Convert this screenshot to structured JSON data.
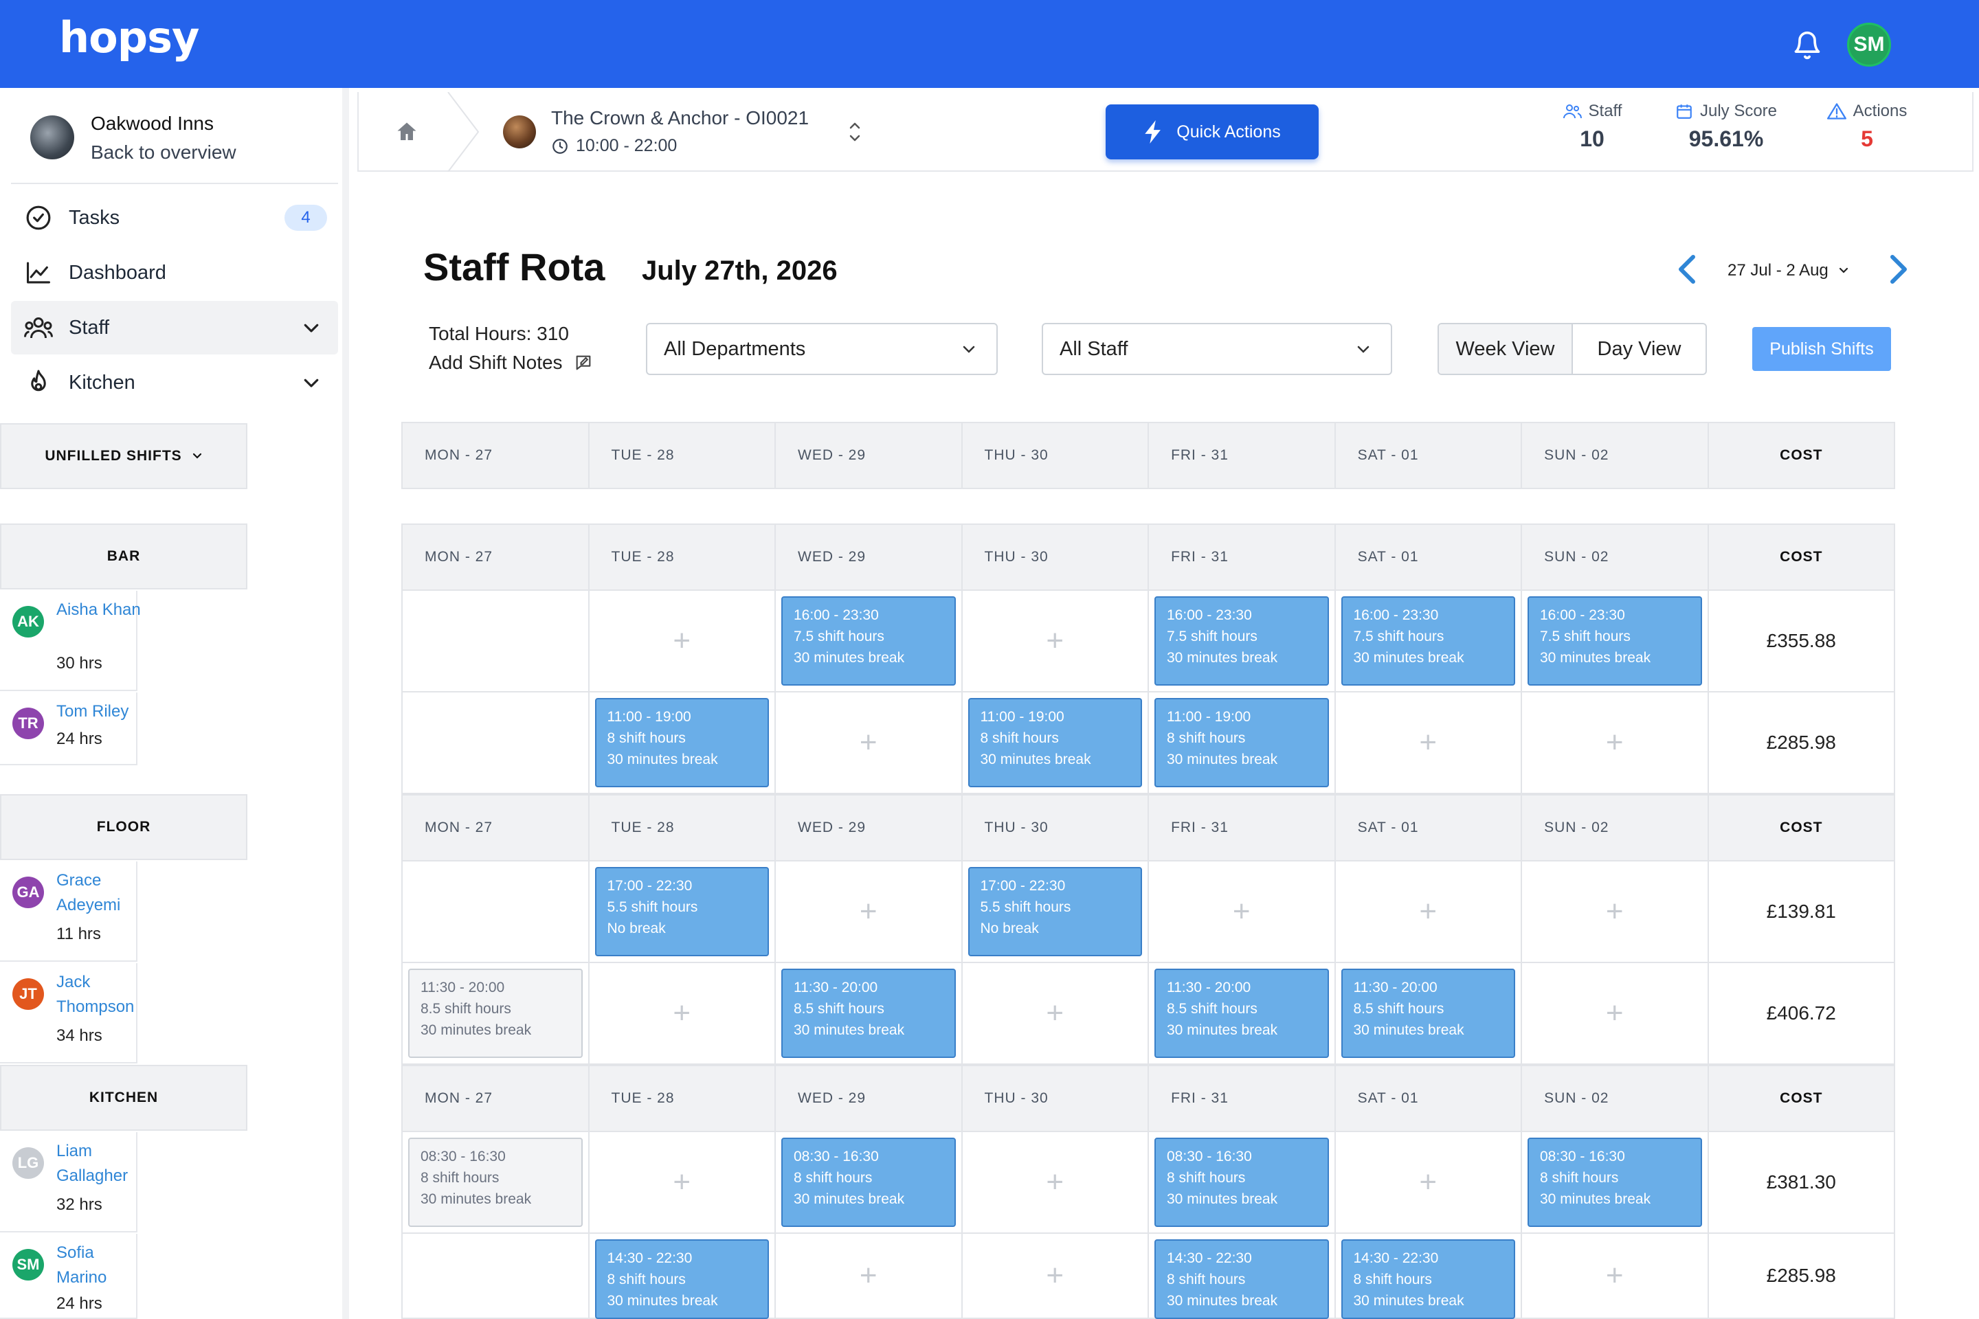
{
  "app": {
    "logo": "hopsy",
    "user_initials": "SM"
  },
  "sidebar": {
    "org_name": "Oakwood Inns",
    "back_label": "Back to overview",
    "items": [
      {
        "label": "Tasks",
        "badge": "4"
      },
      {
        "label": "Dashboard"
      },
      {
        "label": "Staff"
      },
      {
        "label": "Kitchen"
      }
    ],
    "unfilled_label": "UNFILLED SHIFTS",
    "departments": [
      {
        "name": "BAR",
        "employees": [
          {
            "initials": "AK",
            "name": "Aisha Khan",
            "hours": "30 hrs",
            "color": "#1aa66a"
          },
          {
            "initials": "TR",
            "name": "Tom Riley",
            "hours": "24 hrs",
            "color": "#8e44ad"
          }
        ]
      },
      {
        "name": "FLOOR",
        "employees": [
          {
            "initials": "GA",
            "name": "Grace Adeyemi",
            "hours": "11 hrs",
            "color": "#8e44ad"
          },
          {
            "initials": "JT",
            "name": "Jack Thompson",
            "hours": "34 hrs",
            "color": "#e2571e"
          }
        ]
      },
      {
        "name": "KITCHEN",
        "employees": [
          {
            "initials": "LG",
            "name": "Liam Gallagher",
            "hours": "32 hrs",
            "color": "#c8ccd2"
          },
          {
            "initials": "SM",
            "name": "Sofia Marino",
            "hours": "24 hrs",
            "color": "#1aa66a"
          }
        ]
      }
    ]
  },
  "header": {
    "venue_name": "The Crown & Anchor - OI0021",
    "venue_hours": "10:00 - 22:00",
    "quick_actions": "Quick Actions",
    "stats": [
      {
        "label": "Staff",
        "value": "10",
        "icon": "users-icon"
      },
      {
        "label": "July Score",
        "value": "95.61%",
        "icon": "calendar-icon"
      },
      {
        "label": "Actions",
        "value": "5",
        "icon": "warning-icon",
        "color": "#e53935"
      }
    ]
  },
  "rota": {
    "title": "Staff Rota",
    "date": "July 27th, 2026",
    "range": "27 Jul - 2 Aug",
    "total_hours": "Total Hours: 310",
    "add_notes": "Add Shift Notes",
    "department_filter": "All Departments",
    "staff_filter": "All Staff",
    "week_view": "Week View",
    "day_view": "Day View",
    "publish": "Publish Shifts",
    "columns": [
      "MON - 27",
      "TUE - 28",
      "WED - 29",
      "THU - 30",
      "FRI - 31",
      "SAT - 01",
      "SUN - 02",
      "COST"
    ]
  },
  "rows": [
    {
      "cells": [
        null,
        "+",
        {
          "time": "16:00 - 23:30",
          "hours": "7.5 shift hours",
          "break": "30 minutes break"
        },
        "+",
        {
          "time": "16:00 - 23:30",
          "hours": "7.5 shift hours",
          "break": "30 minutes break"
        },
        {
          "time": "16:00 - 23:30",
          "hours": "7.5 shift hours",
          "break": "30 minutes break"
        },
        {
          "time": "16:00 - 23:30",
          "hours": "7.5 shift hours",
          "break": "30 minutes break"
        }
      ],
      "cost": "£355.88"
    },
    {
      "cells": [
        null,
        {
          "time": "11:00 - 19:00",
          "hours": "8 shift hours",
          "break": "30 minutes break"
        },
        "+",
        {
          "time": "11:00 - 19:00",
          "hours": "8 shift hours",
          "break": "30 minutes break"
        },
        {
          "time": "11:00 - 19:00",
          "hours": "8 shift hours",
          "break": "30 minutes break"
        },
        "+",
        "+"
      ],
      "cost": "£285.98"
    },
    {
      "cells": [
        null,
        {
          "time": "17:00 - 22:30",
          "hours": "5.5 shift hours",
          "break": "No break"
        },
        "+",
        {
          "time": "17:00 - 22:30",
          "hours": "5.5 shift hours",
          "break": "No break"
        },
        "+",
        "+",
        "+"
      ],
      "cost": "£139.81"
    },
    {
      "cells": [
        {
          "time": "11:30 - 20:00",
          "hours": "8.5 shift hours",
          "break": "30 minutes break",
          "draft": true
        },
        "+",
        {
          "time": "11:30 - 20:00",
          "hours": "8.5 shift hours",
          "break": "30 minutes break"
        },
        "+",
        {
          "time": "11:30 - 20:00",
          "hours": "8.5 shift hours",
          "break": "30 minutes break"
        },
        {
          "time": "11:30 - 20:00",
          "hours": "8.5 shift hours",
          "break": "30 minutes break"
        },
        "+"
      ],
      "cost": "£406.72"
    },
    {
      "cells": [
        {
          "time": "08:30 - 16:30",
          "hours": "8 shift hours",
          "break": "30 minutes break",
          "draft": true
        },
        "+",
        {
          "time": "08:30 - 16:30",
          "hours": "8 shift hours",
          "break": "30 minutes break"
        },
        "+",
        {
          "time": "08:30 - 16:30",
          "hours": "8 shift hours",
          "break": "30 minutes break"
        },
        "+",
        {
          "time": "08:30 - 16:30",
          "hours": "8 shift hours",
          "break": "30 minutes break"
        }
      ],
      "cost": "£381.30"
    },
    {
      "cells": [
        null,
        {
          "time": "14:30 - 22:30",
          "hours": "8 shift hours",
          "break": "30 minutes break"
        },
        "+",
        "+",
        {
          "time": "14:30 - 22:30",
          "hours": "8 shift hours",
          "break": "30 minutes break"
        },
        {
          "time": "14:30 - 22:30",
          "hours": "8 shift hours",
          "break": "30 minutes break"
        },
        "+"
      ],
      "cost": "£285.98"
    }
  ]
}
